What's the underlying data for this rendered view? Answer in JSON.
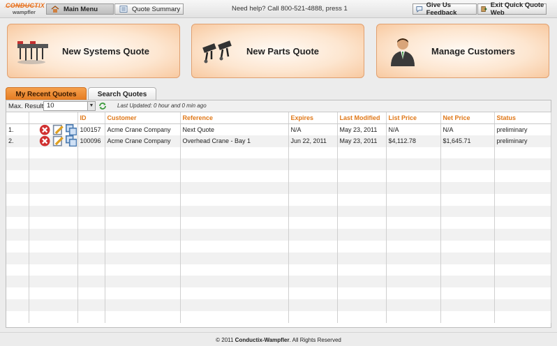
{
  "brand": {
    "line1": "CONDUCTIX",
    "line2": "wampfler"
  },
  "nav": {
    "main_menu": "Main Menu",
    "quote_summary": "Quote Summary",
    "help_text": "Need help? Call 800-521-4888, press 1",
    "feedback": "Give Us Feedback",
    "exit": "Exit Quick Quote Web"
  },
  "big_buttons": {
    "systems": "New Systems Quote",
    "parts": "New Parts Quote",
    "customers": "Manage Customers"
  },
  "tabs": {
    "recent": "My Recent Quotes",
    "search": "Search Quotes"
  },
  "filter": {
    "max_results_label": "Max. Results",
    "max_results_value": "10",
    "last_updated": "Last Updated: 0 hour and 0 min ago"
  },
  "columns": [
    "",
    "",
    "ID",
    "Customer",
    "Reference",
    "Expires",
    "Last Modified",
    "List Price",
    "Net Price",
    "Status"
  ],
  "rows": [
    {
      "num": "1.",
      "id": "100157",
      "customer": "Acme Crane Company",
      "reference": "Next Quote",
      "expires": "N/A",
      "modified": "May 23, 2011",
      "list": "N/A",
      "net": "N/A",
      "status": "preliminary"
    },
    {
      "num": "2.",
      "id": "100096",
      "customer": "Acme Crane Company",
      "reference": "Overhead Crane - Bay 1",
      "expires": "Jun 22, 2011",
      "modified": "May 23, 2011",
      "list": "$4,112.78",
      "net": "$1,645.71",
      "status": "preliminary"
    }
  ],
  "footer": {
    "prefix": "© 2011 ",
    "company": "Conductix-Wampfler",
    "suffix": ". All Rights Reserved"
  },
  "colors": {
    "accent": "#e47a20",
    "header_text": "#e07818"
  },
  "icons": [
    "home-icon",
    "document-icon",
    "feedback-icon",
    "exit-icon",
    "delete-icon",
    "edit-icon",
    "copy-icon",
    "refresh-icon"
  ]
}
